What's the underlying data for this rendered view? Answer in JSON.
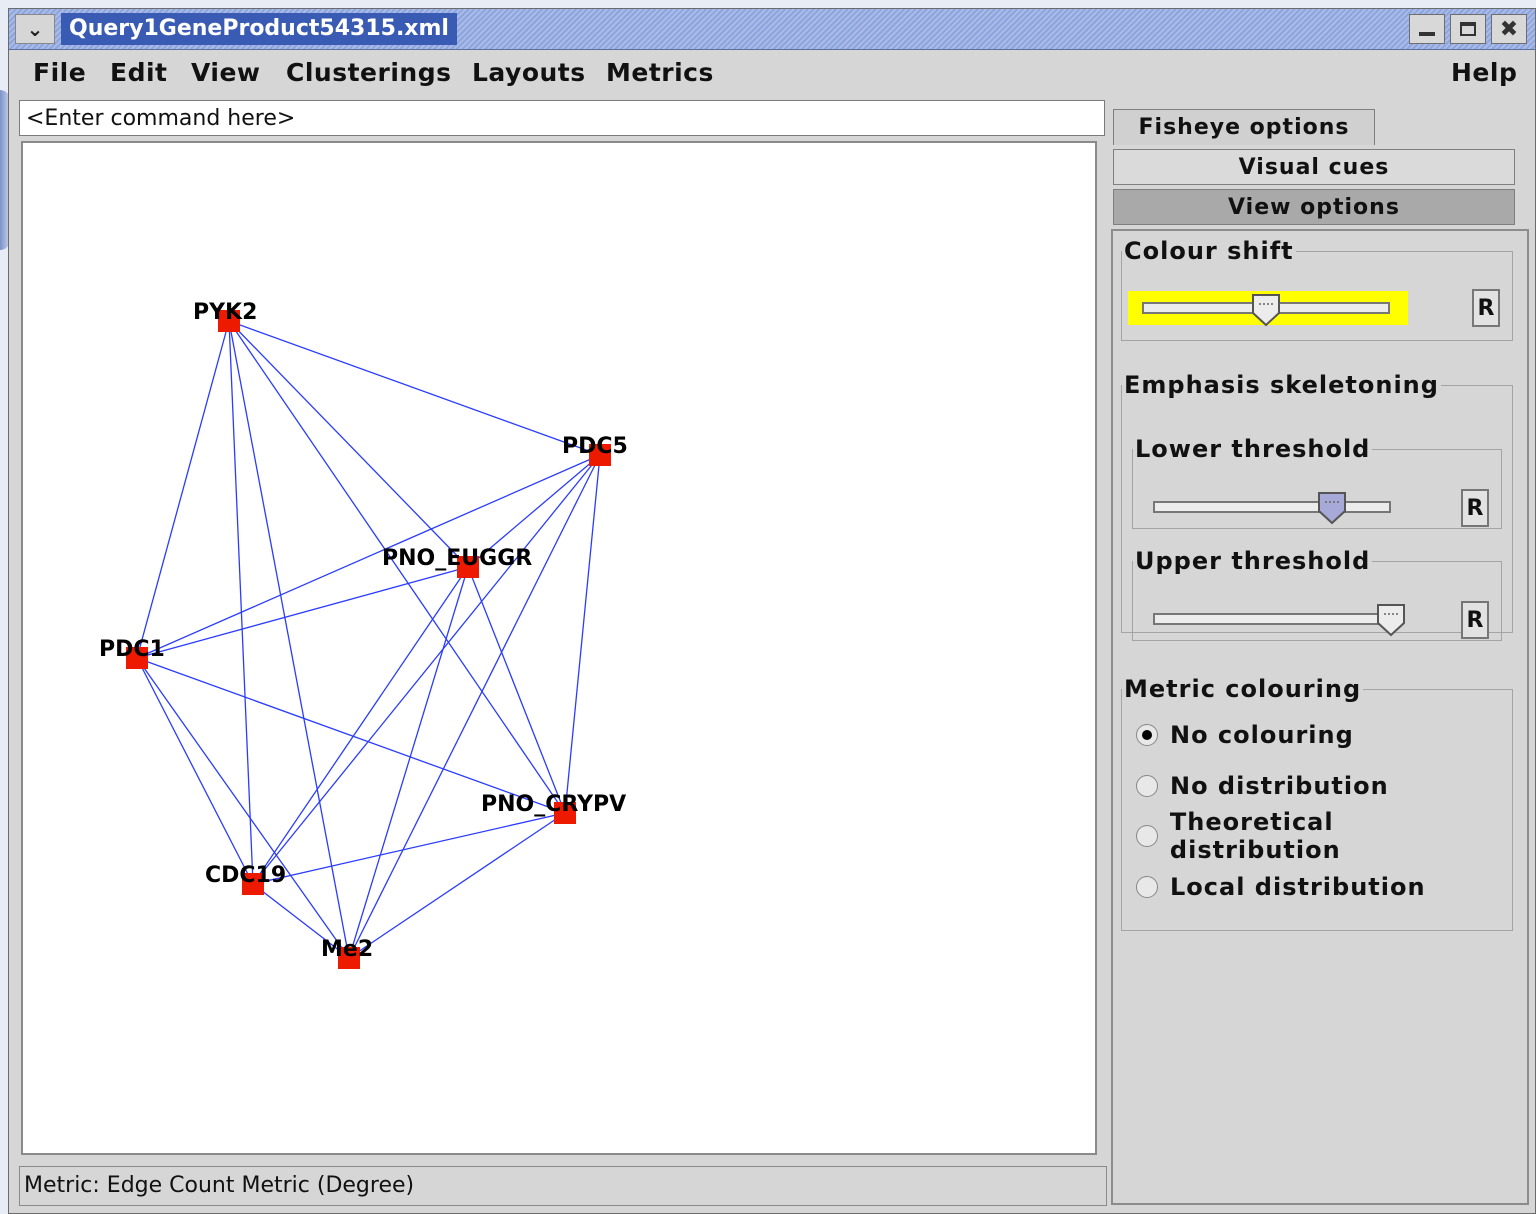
{
  "window": {
    "title": "Query1GeneProduct54315.xml"
  },
  "menubar": {
    "items": [
      "File",
      "Edit",
      "View",
      "Clusterings",
      "Layouts",
      "Metrics"
    ],
    "help": "Help"
  },
  "command": {
    "placeholder": "<Enter command here>"
  },
  "graph": {
    "nodes": [
      {
        "id": "PYK2",
        "label": "PYK2"
      },
      {
        "id": "PDC5",
        "label": "PDC5"
      },
      {
        "id": "PNO_EUGGR",
        "label": "PNO_EUGGR"
      },
      {
        "id": "PDC1",
        "label": "PDC1"
      },
      {
        "id": "PNO_CRYPV",
        "label": "PNO_CRYPV"
      },
      {
        "id": "CDC19",
        "label": "CDC19"
      },
      {
        "id": "Me2",
        "label": "Me2"
      }
    ],
    "edges": [
      [
        "PYK2",
        "PDC5"
      ],
      [
        "PYK2",
        "PDC1"
      ],
      [
        "PYK2",
        "CDC19"
      ],
      [
        "PYK2",
        "Me2"
      ],
      [
        "PYK2",
        "PNO_CRYPV"
      ],
      [
        "PYK2",
        "PNO_EUGGR"
      ],
      [
        "PDC5",
        "PDC1"
      ],
      [
        "PDC5",
        "PNO_EUGGR"
      ],
      [
        "PDC5",
        "CDC19"
      ],
      [
        "PDC5",
        "Me2"
      ],
      [
        "PDC5",
        "PNO_CRYPV"
      ],
      [
        "PNO_EUGGR",
        "PDC1"
      ],
      [
        "PNO_EUGGR",
        "CDC19"
      ],
      [
        "PNO_EUGGR",
        "Me2"
      ],
      [
        "PNO_EUGGR",
        "PNO_CRYPV"
      ],
      [
        "PDC1",
        "PNO_CRYPV"
      ],
      [
        "PDC1",
        "CDC19"
      ],
      [
        "PDC1",
        "Me2"
      ],
      [
        "PNO_CRYPV",
        "CDC19"
      ],
      [
        "PNO_CRYPV",
        "Me2"
      ],
      [
        "CDC19",
        "Me2"
      ]
    ],
    "node_color": "#ee1a00",
    "edge_color": "#2a3cff"
  },
  "status": {
    "text": "Metric: Edge Count Metric (Degree)"
  },
  "tabs": {
    "fisheye": "Fisheye options",
    "visual": "Visual cues",
    "view": "View options"
  },
  "options": {
    "colour_shift": {
      "title": "Colour shift",
      "reset": "R",
      "value": 0.5
    },
    "emphasis": {
      "title": "Emphasis skeletoning",
      "lower": {
        "title": "Lower threshold",
        "reset": "R",
        "value": 0.75
      },
      "upper": {
        "title": "Upper threshold",
        "reset": "R",
        "value": 1.0
      }
    },
    "metric_colouring": {
      "title": "Metric colouring",
      "options": [
        "No colouring",
        "No distribution",
        "Theoretical distribution",
        "Local distribution"
      ],
      "selected": "No colouring"
    }
  }
}
